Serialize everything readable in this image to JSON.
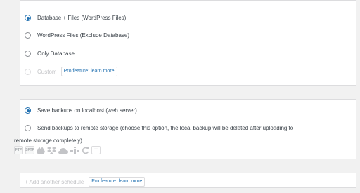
{
  "backup_content": {
    "options": [
      {
        "label": "Database + Files (WordPress Files)",
        "checked": true
      },
      {
        "label": "WordPress Files (Exclude Database)",
        "checked": false
      },
      {
        "label": "Only Database",
        "checked": false
      },
      {
        "label": "Custom",
        "checked": false,
        "disabled": true,
        "badge": "Pro feature: learn more"
      }
    ]
  },
  "backup_location": {
    "localhost_label": "Save backups on localhost (web server)",
    "remote_label_line1": "Send backups to remote storage (choose this option, the local backup will be deleted after uploading to",
    "remote_label_line2": "remote storage completely)",
    "icons": [
      "ftp-icon",
      "sftp-icon",
      "google-drive-icon",
      "dropbox-icon",
      "onedrive-icon",
      "amazon-s3-icon",
      "refresh-icon",
      "add-storage-icon"
    ],
    "ftp_text": "FTP",
    "sftp_text": "SFTP",
    "plus_text": "+"
  },
  "schedule": {
    "add_label": "+ Add another schedule",
    "badge": "Pro feature: learn more"
  }
}
